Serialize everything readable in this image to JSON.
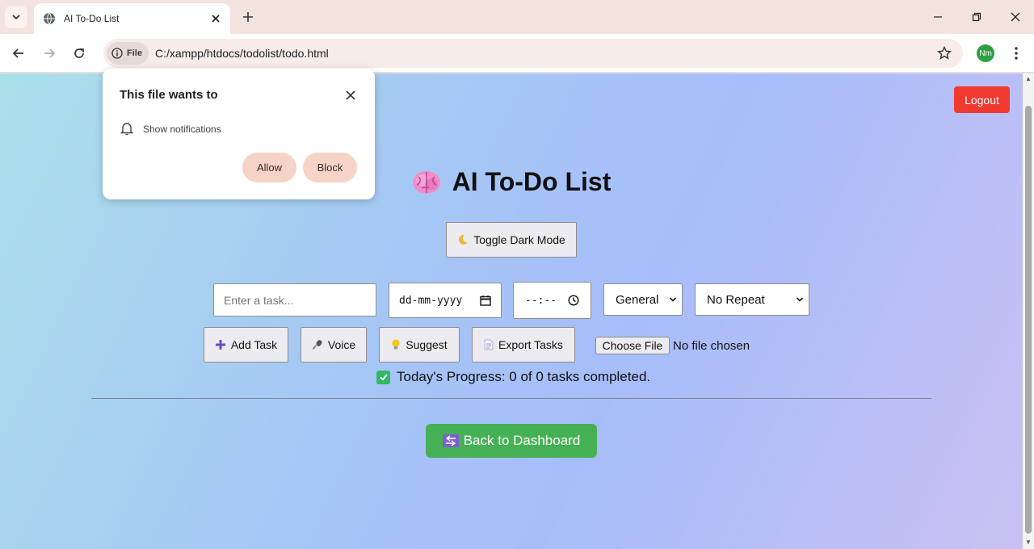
{
  "browser": {
    "tab_title": "AI To-Do List",
    "url": "C:/xampp/htdocs/todolist/todo.html",
    "security_chip": "File",
    "profile_initials": "Nm"
  },
  "popup": {
    "title": "This file wants to",
    "permission": "Show notifications",
    "allow_label": "Allow",
    "block_label": "Block"
  },
  "page": {
    "logout_label": "Logout",
    "title": "AI To-Do List",
    "toggle_label": "Toggle Dark Mode",
    "task_placeholder": "Enter a task...",
    "date_value": "dd-mm-yyyy",
    "time_value": "--:--",
    "category_value": "General",
    "repeat_value": "No Repeat",
    "add_label": "Add Task",
    "voice_label": "Voice",
    "suggest_label": "Suggest",
    "export_label": "Export Tasks",
    "choose_file_label": "Choose File",
    "no_file_text": "No file chosen",
    "progress_text": "Today's Progress: 0 of 0 tasks completed.",
    "back_label": "Back to Dashboard"
  },
  "colors": {
    "logout": "#f03a2f",
    "back": "#46b154",
    "popup_button": "#f6d3c7"
  }
}
